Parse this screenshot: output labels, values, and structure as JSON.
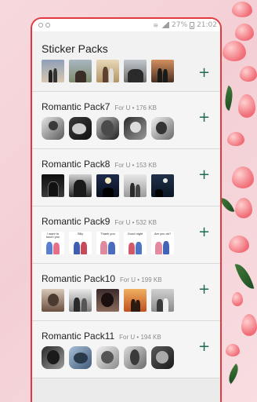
{
  "status_bar": {
    "battery_percent": "27%",
    "time": "21:02"
  },
  "header": {
    "title": "Sticker Packs"
  },
  "packs": [
    {
      "name": "Romantic Pack7",
      "source": "For U",
      "size": "176 KB"
    },
    {
      "name": "Romantic Pack8",
      "source": "For U",
      "size": "153 KB"
    },
    {
      "name": "Romantic Pack9",
      "source": "For U",
      "size": "532 KB"
    },
    {
      "name": "Romantic Pack10",
      "source": "For U",
      "size": "199 KB"
    },
    {
      "name": "Romantic Pack11",
      "source": "For U",
      "size": "194 KB"
    }
  ],
  "pack9_captions": [
    "I want to touch you",
    "Silly",
    "Thank you",
    "Good night",
    "Are you ok?"
  ],
  "add_label": "+",
  "meta_separator": "•",
  "colors": {
    "frame": "#e2383f",
    "add_button": "#1f6b4f",
    "list_background": "#ebebeb"
  },
  "icons": [
    "whatsapp-icon",
    "notification-icon",
    "wifi-icon",
    "signal-icon",
    "battery-icon",
    "add-icon"
  ]
}
